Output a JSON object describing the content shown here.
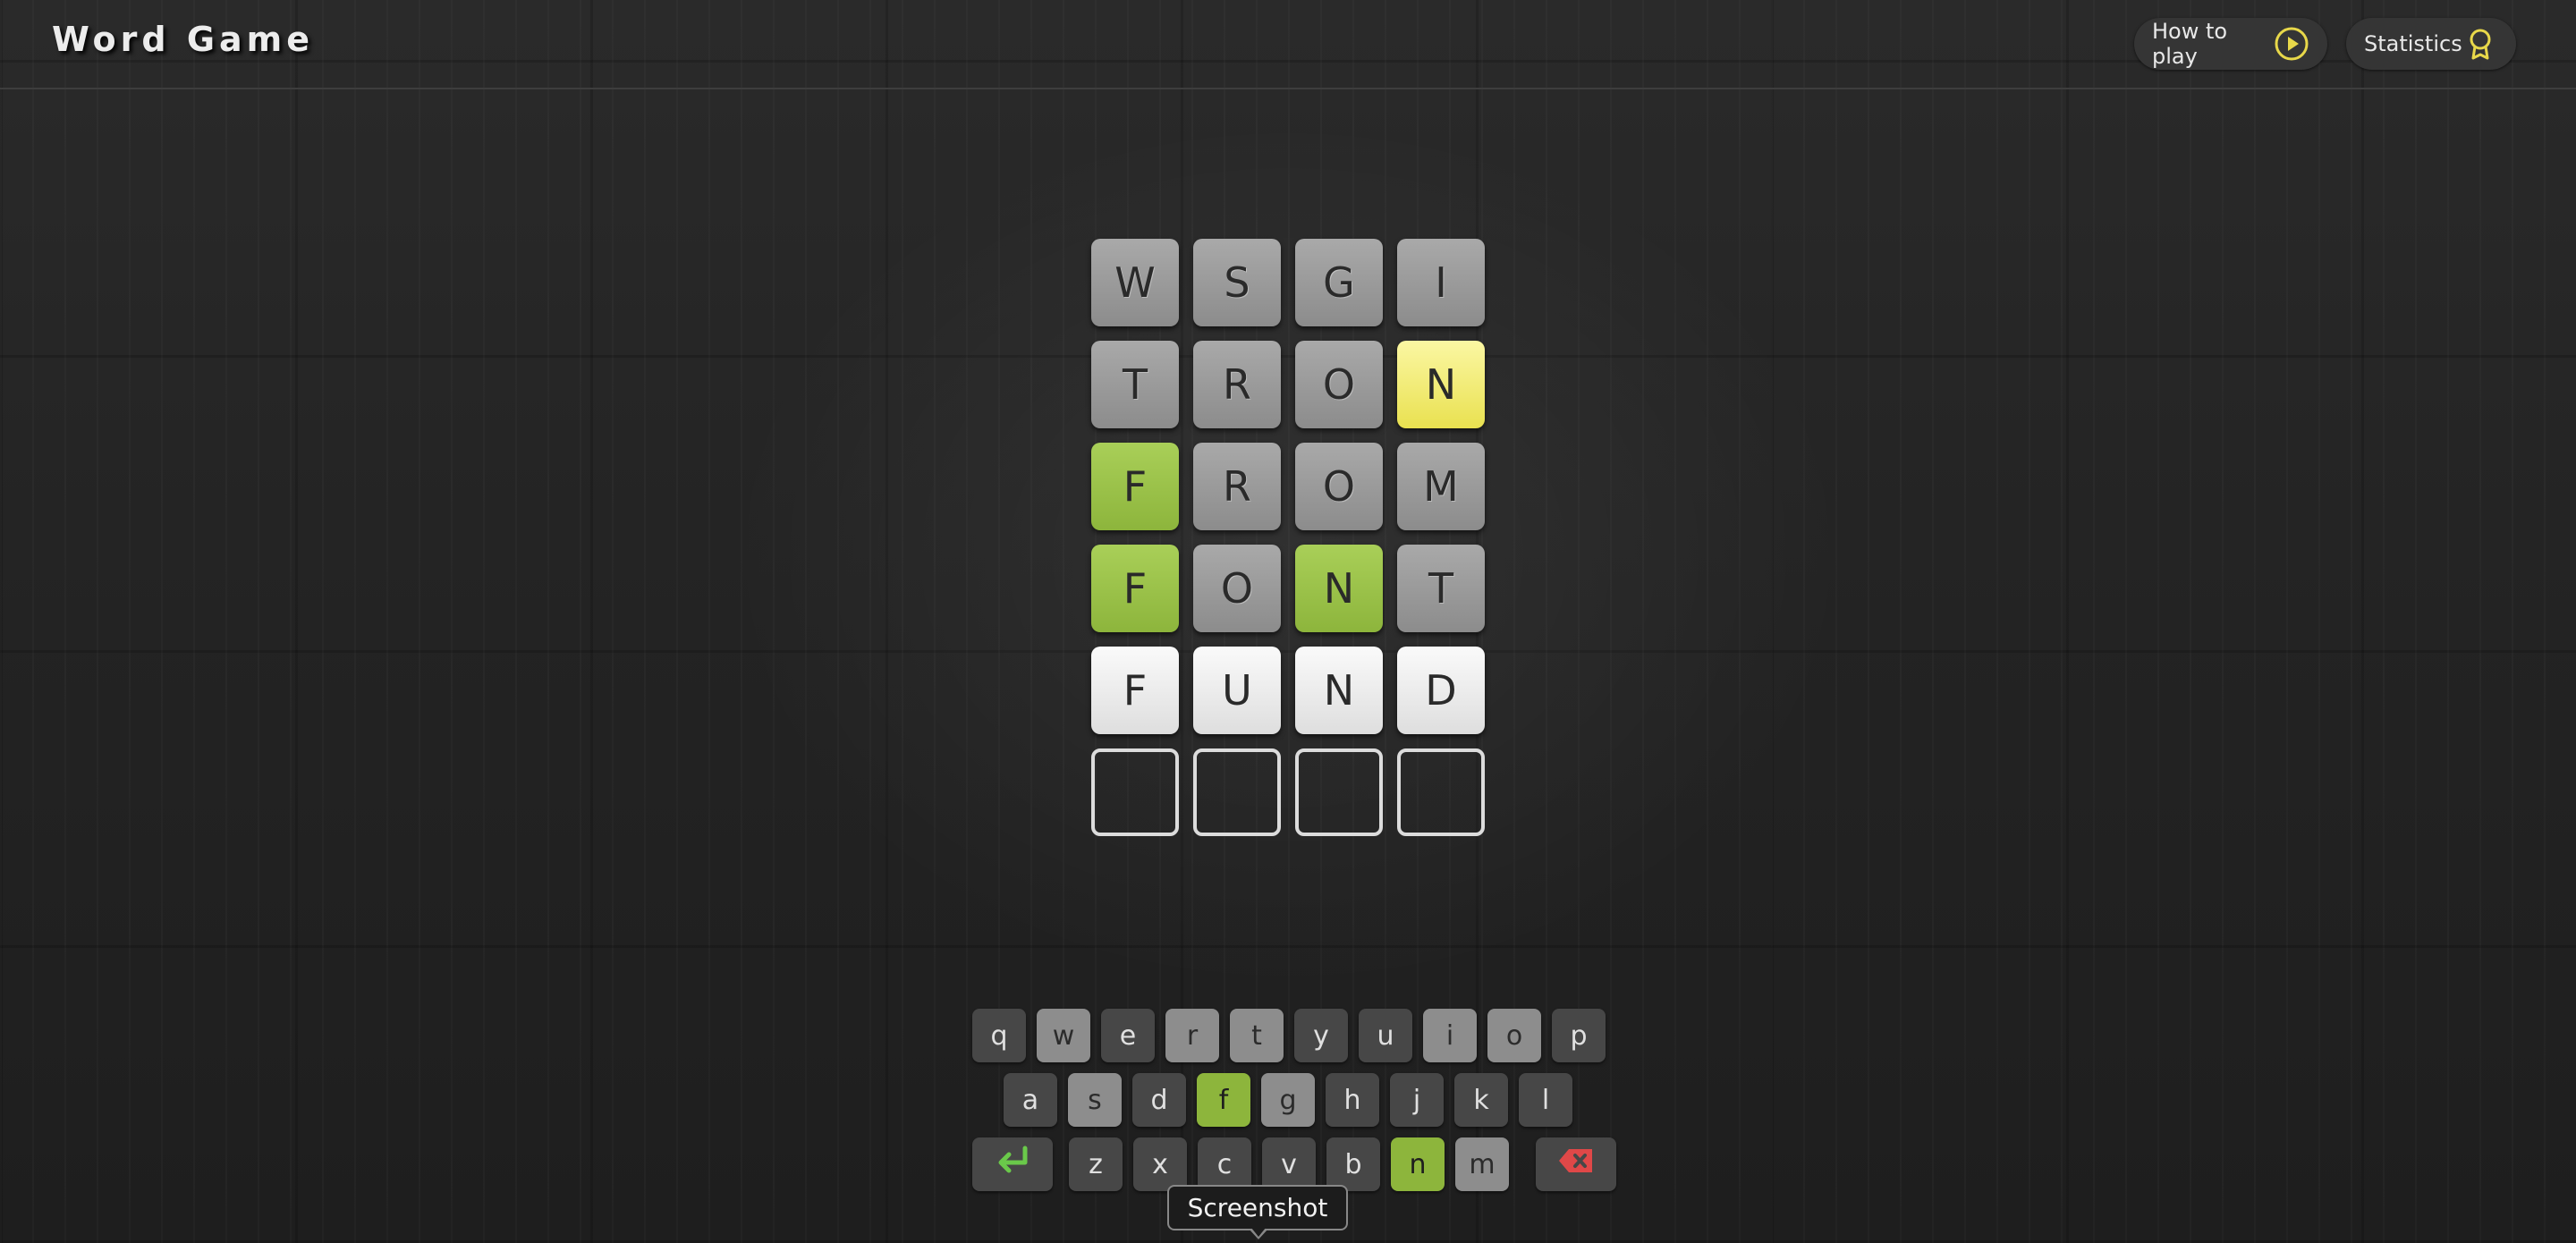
{
  "header": {
    "title": "Word Game",
    "how_to_play": {
      "label": "How to play",
      "icon": "play-circle-icon"
    },
    "statistics": {
      "label": "Statistics",
      "icon": "award-ribbon-icon"
    }
  },
  "colors": {
    "correct": "#8db53c",
    "present": "#e9e150",
    "absent": "#8c8c8c",
    "accent_icon": "#e8d84a",
    "enter_arrow": "#6ac94a",
    "backspace": "#e04848"
  },
  "board": {
    "rows": [
      {
        "letters": [
          "W",
          "S",
          "G",
          "I"
        ],
        "states": [
          "absent",
          "absent",
          "absent",
          "absent"
        ]
      },
      {
        "letters": [
          "T",
          "R",
          "O",
          "N"
        ],
        "states": [
          "absent",
          "absent",
          "absent",
          "present"
        ]
      },
      {
        "letters": [
          "F",
          "R",
          "O",
          "M"
        ],
        "states": [
          "correct",
          "absent",
          "absent",
          "absent"
        ]
      },
      {
        "letters": [
          "F",
          "O",
          "N",
          "T"
        ],
        "states": [
          "correct",
          "absent",
          "correct",
          "absent"
        ]
      },
      {
        "letters": [
          "F",
          "U",
          "N",
          "D"
        ],
        "states": [
          "typed",
          "typed",
          "typed",
          "typed"
        ]
      },
      {
        "letters": [
          "",
          "",
          "",
          ""
        ],
        "states": [
          "empty",
          "empty",
          "empty",
          "empty"
        ]
      }
    ]
  },
  "keyboard": {
    "rows": [
      [
        {
          "key": "q",
          "state": "unused"
        },
        {
          "key": "w",
          "state": "absent"
        },
        {
          "key": "e",
          "state": "unused"
        },
        {
          "key": "r",
          "state": "absent"
        },
        {
          "key": "t",
          "state": "absent"
        },
        {
          "key": "y",
          "state": "unused"
        },
        {
          "key": "u",
          "state": "unused"
        },
        {
          "key": "i",
          "state": "absent"
        },
        {
          "key": "o",
          "state": "absent"
        },
        {
          "key": "p",
          "state": "unused"
        }
      ],
      [
        {
          "key": "a",
          "state": "unused"
        },
        {
          "key": "s",
          "state": "absent"
        },
        {
          "key": "d",
          "state": "unused"
        },
        {
          "key": "f",
          "state": "correct"
        },
        {
          "key": "g",
          "state": "absent"
        },
        {
          "key": "h",
          "state": "unused"
        },
        {
          "key": "j",
          "state": "unused"
        },
        {
          "key": "k",
          "state": "unused"
        },
        {
          "key": "l",
          "state": "unused"
        }
      ],
      [
        {
          "key": "",
          "state": "unused",
          "special": "enter",
          "icon": "enter-icon"
        },
        {
          "key": "z",
          "state": "unused"
        },
        {
          "key": "x",
          "state": "unused"
        },
        {
          "key": "c",
          "state": "unused"
        },
        {
          "key": "v",
          "state": "unused"
        },
        {
          "key": "b",
          "state": "unused"
        },
        {
          "key": "n",
          "state": "correct"
        },
        {
          "key": "m",
          "state": "absent"
        },
        {
          "key": "",
          "state": "unused",
          "special": "backspace",
          "icon": "backspace-icon"
        }
      ]
    ]
  },
  "tooltip": {
    "text": "Screenshot"
  }
}
